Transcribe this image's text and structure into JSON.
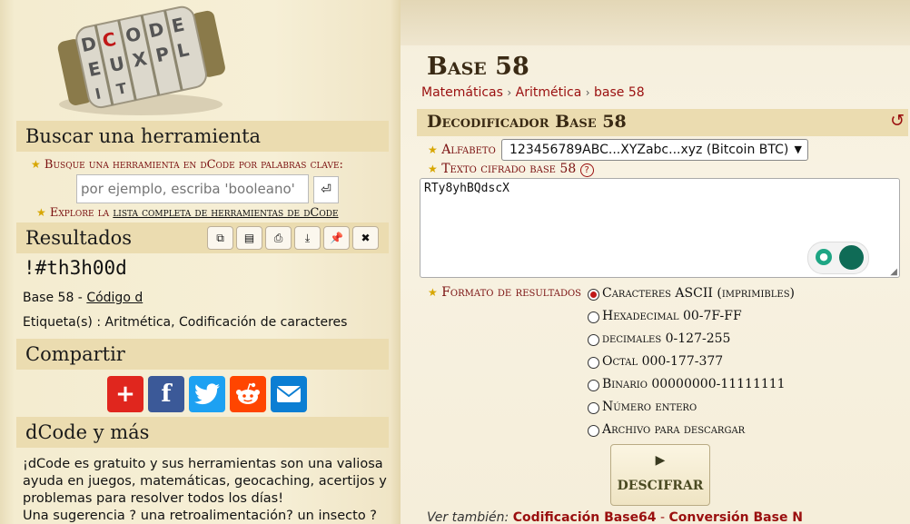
{
  "logo": {
    "text": "dCODE",
    "wheel_letters": [
      "D",
      "C",
      "O",
      "D",
      "E",
      "E",
      "U",
      "X",
      "P",
      "L",
      "I",
      "T"
    ]
  },
  "search": {
    "header": "Buscar una herramienta",
    "hint": "Busque una herramienta en dCode por palabras clave:",
    "placeholder": "por ejemplo, escriba 'booleano'",
    "go_symbol": "⏎",
    "explore_prefix": "Explore la",
    "explore_link": "lista completa de herramientas de dCode"
  },
  "results": {
    "header": "Resultados",
    "value": "!#th3h00d",
    "method_prefix": "Base 58 - ",
    "method_link": "Código d",
    "tags": "Etiqueta(s) : Aritmética, Codificación de caracteres",
    "toolbar": [
      "⧉",
      "▤",
      "⎙",
      "⤓",
      "📌",
      "✖"
    ]
  },
  "share": {
    "header": "Compartir",
    "buttons": [
      {
        "name": "addthis",
        "glyph": "+",
        "color": "#e0261e"
      },
      {
        "name": "facebook",
        "glyph": "f",
        "color": "#3b5998"
      },
      {
        "name": "twitter",
        "glyph": "t",
        "color": "#1da1f2"
      },
      {
        "name": "reddit",
        "glyph": "r",
        "color": "#ff4500"
      },
      {
        "name": "email",
        "glyph": "✉",
        "color": "#0b7ed3"
      }
    ]
  },
  "more": {
    "header": "dCode y más",
    "text1": "¡dCode es gratuito y sus herramientas son una valiosa ayuda en juegos, matemáticas, geocaching, acertijos y problemas para resolver todos los días!",
    "text2": "Una sugerencia ? una retroalimentación? un insecto ?"
  },
  "page": {
    "title": "Base 58",
    "breadcrumb": [
      "Matemáticas",
      "Aritmética",
      "base 58"
    ],
    "breadcrumb_sep": "›"
  },
  "decoder": {
    "title": "Decodificador Base 58",
    "refresh_icon": "↺",
    "alphabet_label": "Alfabeto",
    "alphabet_value": "123456789ABC...XYZabc...xyz (Bitcoin BTC)",
    "cipher_label": "Texto cifrado base 58",
    "help": "?",
    "cipher_text": "RTy8yhBQdscX",
    "format_label": "Formato de resultados",
    "formats": [
      "Caracteres ASCII (imprimibles)",
      "Hexadecimal 00-7F-FF",
      "decimales 0-127-255",
      "Octal 000-177-377",
      "Binario 00000000-11111111",
      "Número entero",
      "Archivo para descargar"
    ],
    "selected_format": 0,
    "decrypt_label": "DESCIFRAR",
    "play_icon": "▶"
  },
  "see_also": {
    "prefix": "Ver también:",
    "links": [
      "Codificación Base64",
      "Conversión Base N"
    ],
    "sep": "-"
  },
  "colors": {
    "accent_red": "#9a0f0f",
    "header_bg": "#ebdcb0",
    "panel_bg": "#f6efd6"
  }
}
